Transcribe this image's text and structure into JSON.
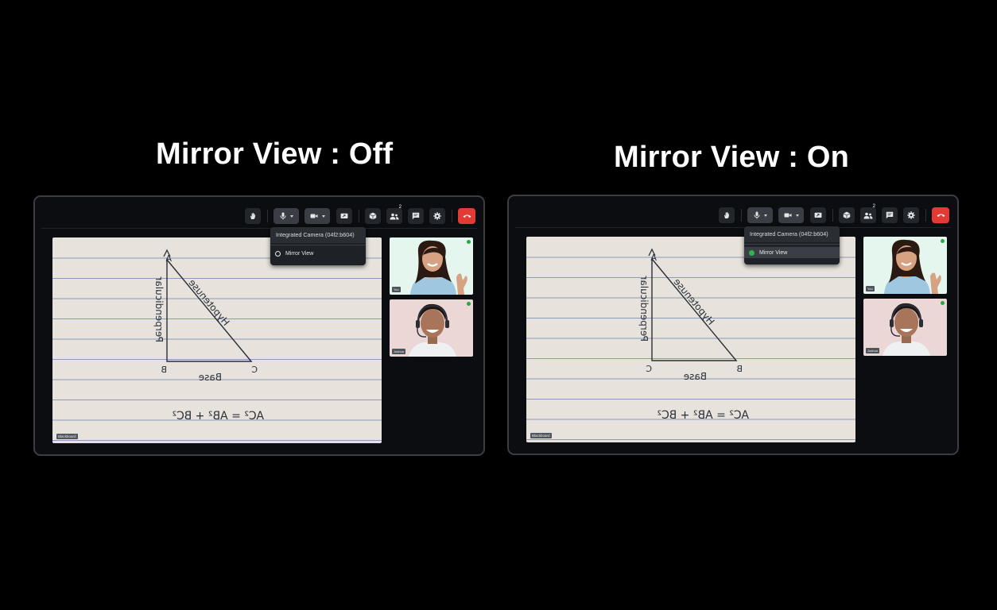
{
  "headings": {
    "left": "Mirror View : Off",
    "right": "Mirror View : On"
  },
  "panels": [
    {
      "toolbar_icons": [
        "raise-hand-icon",
        "microphone-icon",
        "camera-icon",
        "screen-share-icon",
        "cube-icon",
        "participants-icon",
        "chat-icon",
        "settings-icon",
        "end-call-icon"
      ],
      "participants_badge": "2",
      "camera_menu": {
        "header": "Integrated Camera (04f2:b604)",
        "item_label": "Mirror View",
        "item_selected": false
      },
      "whiteboard": {
        "label": "Blackboard",
        "mirrored": true,
        "vertex_top": "A",
        "vertex_left": "C",
        "vertex_right": "B",
        "side_hypotenuse": "Hypotenuse",
        "side_vertical": "Perpendicular",
        "side_base": "Base",
        "equation": "AC² = AB² + BC²"
      },
      "participants": [
        {
          "name": "You"
        },
        {
          "name": "Joshua"
        }
      ]
    },
    {
      "toolbar_icons": [
        "raise-hand-icon",
        "microphone-icon",
        "camera-icon",
        "screen-share-icon",
        "cube-icon",
        "participants-icon",
        "chat-icon",
        "settings-icon",
        "end-call-icon"
      ],
      "participants_badge": "2",
      "camera_menu": {
        "header": "Integrated Camera (04f2:b604)",
        "item_label": "Mirror View",
        "item_selected": true
      },
      "whiteboard": {
        "label": "Blackboard",
        "mirrored": false,
        "vertex_top": "A",
        "vertex_left": "B",
        "vertex_right": "C",
        "side_hypotenuse": "Hypotenuse",
        "side_vertical": "Perpendicular",
        "side_base": "Base",
        "equation": "AC² = AB² + BC²"
      },
      "participants": [
        {
          "name": "You"
        },
        {
          "name": "Joshua"
        }
      ]
    }
  ],
  "colors": {
    "background": "#000000",
    "end_call": "#e23b35",
    "mirror_on_indicator": "#2fb34a",
    "paper": "#e7e3dc",
    "rule_lines": "#8a9bb8",
    "ink": "#2b2f3a"
  }
}
